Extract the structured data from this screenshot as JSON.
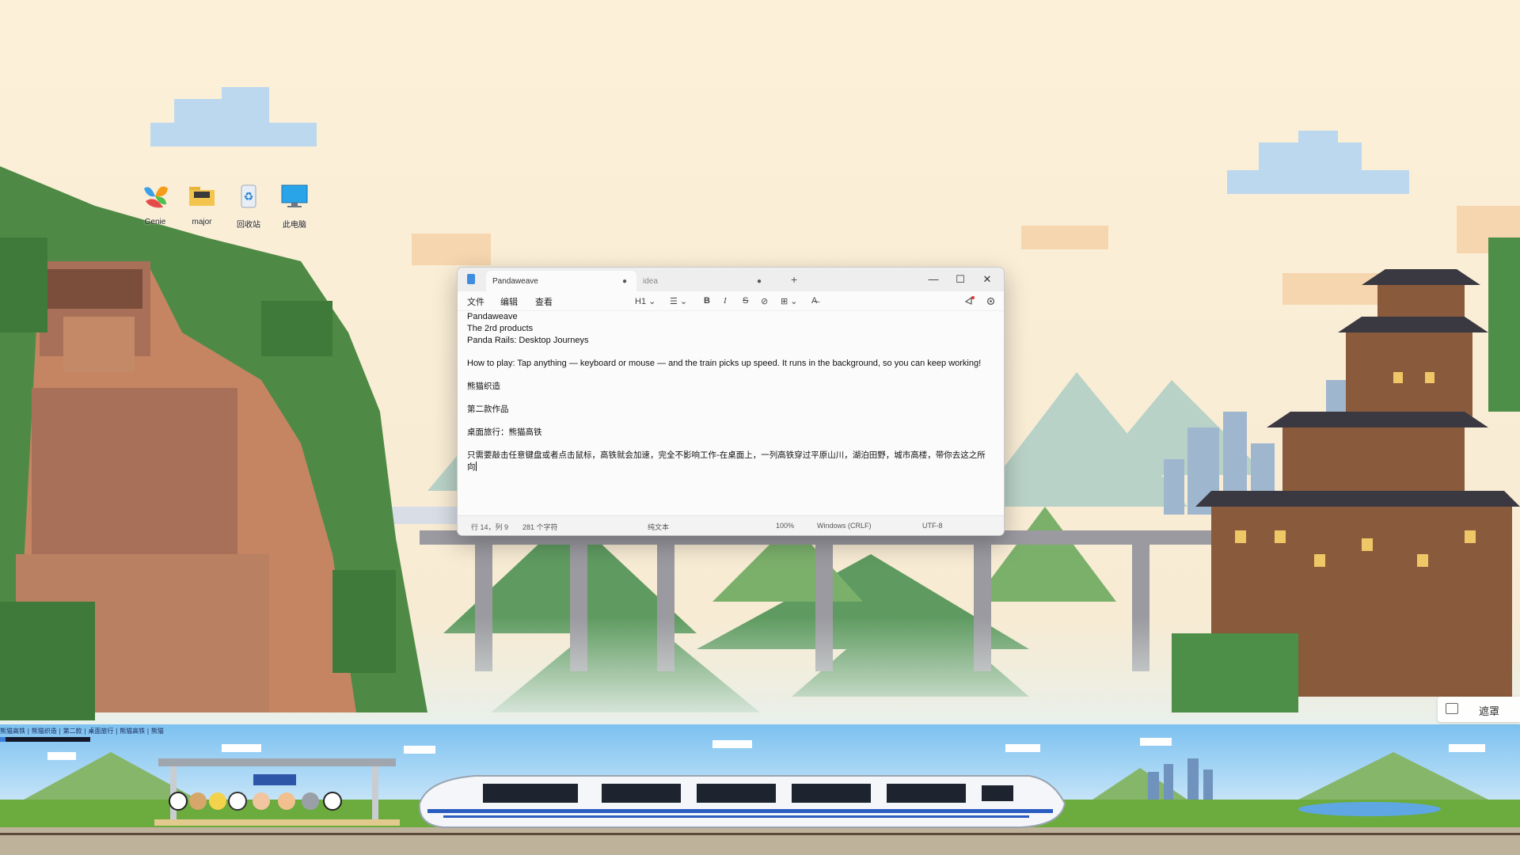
{
  "desktop": {
    "icons": [
      {
        "name": "browser-icon",
        "label": "Genie"
      },
      {
        "name": "folder-icon",
        "label": "major"
      },
      {
        "name": "recycle-bin-icon",
        "label": "回收站"
      },
      {
        "name": "computer-icon",
        "label": "此电脑"
      }
    ]
  },
  "notepad": {
    "tabs": [
      {
        "label": "Pandaweave",
        "dot": "●"
      },
      {
        "label": "idea",
        "dot": "●"
      }
    ],
    "new_tab": "+",
    "window_buttons": {
      "minimize": "—",
      "maximize": "☐",
      "close": "✕"
    },
    "menu": {
      "file": "文件",
      "edit": "编辑",
      "view": "查看"
    },
    "toolbar": {
      "heading": "H1 ⌄",
      "list": "☰ ⌄",
      "bold": "B",
      "italic": "I",
      "strike": "S",
      "link": "⊘",
      "table": "⊞ ⌄",
      "clear": "A̶"
    },
    "content": {
      "line1": "Pandaweave",
      "line2": "The 2rd products",
      "line3": "Panda Rails: Desktop Journeys",
      "line4": "How to play: Tap anything — keyboard or mouse — and the train picks up speed. It runs in the background, so you can keep working!",
      "line5": "熊猫织造",
      "line6": "第二款作品",
      "line7": "桌面旅行：熊猫高铁",
      "line8": "只需要敲击任意键盘或者点击鼠标，高铁就会加速，完全不影响工作-在桌面上，一列高铁穿过平原山川，湖泊田野，城市高楼，带你去这之所向"
    },
    "status": {
      "position": "行 14，列 9",
      "chars": "281 个字符",
      "format": "纯文本",
      "zoom": "100%",
      "eol": "Windows (CRLF)",
      "encoding": "UTF-8"
    }
  },
  "overlay": {
    "mask_button": "遮罩",
    "sign_text": "熊猫高铁 | 熊猫织造 | 第二款 | 桌面旅行 | 熊猫高铁 | 熊猫"
  },
  "train_progress": 0.06,
  "colors": {
    "sky": "#fbf1dc",
    "accent": "#3f8de0"
  }
}
